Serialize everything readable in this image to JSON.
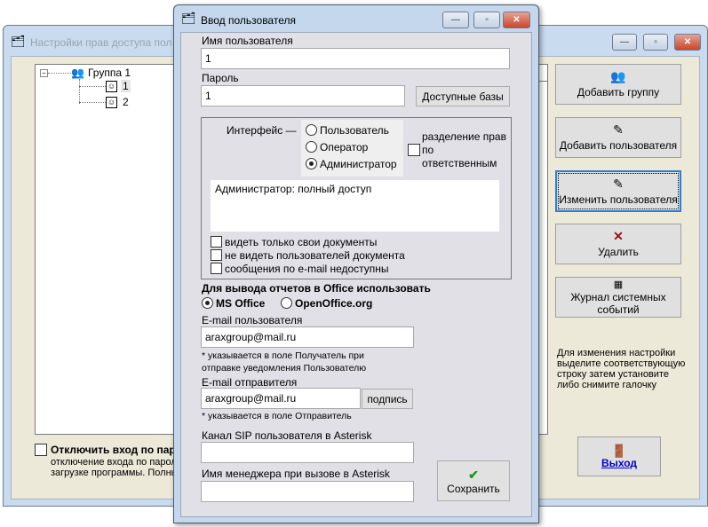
{
  "bg_window": {
    "title": "Настройки прав доступа пол",
    "tree": [
      {
        "label": "Группа 1",
        "children": [
          "1",
          "2"
        ]
      }
    ],
    "buttons": {
      "add_group": "Добавить группу",
      "add_user": "Добавить пользователя",
      "edit_user": "Изменить пользователя",
      "delete": "Удалить",
      "journal": "Журнал системных событий",
      "exit": "Выход"
    },
    "hint": "Для изменения настройки выделите соответствующую строку затем установите либо снимите галочку",
    "disable_login_label": "Отключить вход по паро",
    "disable_login_desc1": "отключение входа по паролк",
    "disable_login_desc2": "загрузке программы. Полны"
  },
  "dialog": {
    "title": "Ввод пользователя",
    "username_label": "Имя пользователя",
    "username_value": "1",
    "password_label": "Пароль",
    "password_value": "1",
    "available_db_button": "Доступные базы",
    "interface_label": "Интерфейс —",
    "interface_options": [
      "Пользователь",
      "Оператор",
      "Администратор"
    ],
    "interface_selected": "Администратор",
    "split_rights_label": "разделение прав по ответственным",
    "description": "Администратор: полный доступ",
    "checks": [
      "видеть только свои документы",
      "не видеть пользователей документа",
      "сообщения по e-mail недоступны"
    ],
    "office_label": "Для вывода отчетов в Office использовать",
    "office_options": [
      "MS Office",
      "OpenOffice.org"
    ],
    "office_selected": "MS Office",
    "email_user_label": "E-mail пользователя",
    "email_user_value": "araxgroup@mail.ru",
    "email_user_note1": "* указывается в поле Получатель при",
    "email_user_note2": "отправке уведомления Пользователю",
    "email_sender_label": "E-mail отправителя",
    "email_sender_value": "araxgroup@mail.ru",
    "signature_button": "подпись",
    "email_sender_note": "* указывается в поле Отправитель",
    "sip_label": "Канал SIP пользователя в Asterisk",
    "sip_value": "",
    "manager_label": "Имя менеджера при вызове в Asterisk",
    "manager_value": "",
    "save_button": "Сохранить"
  }
}
